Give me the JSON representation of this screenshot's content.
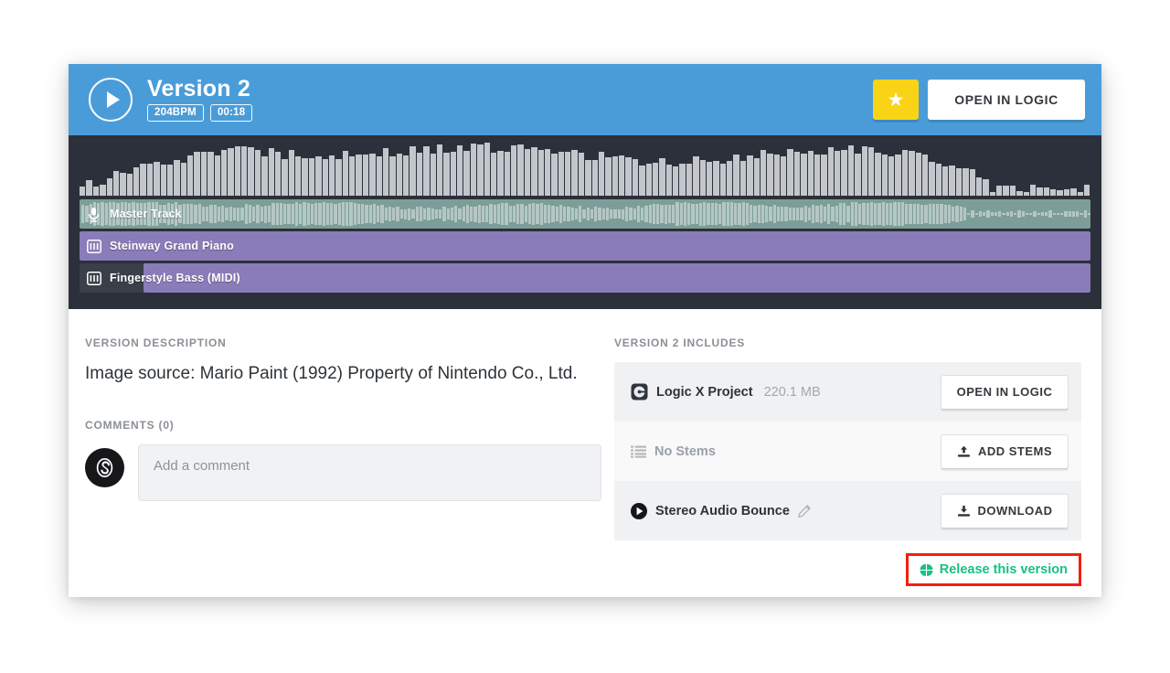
{
  "header": {
    "play_icon": "play-icon",
    "title": "Version 2",
    "bpm_badge": "204BPM",
    "duration_badge": "00:18",
    "star_icon": "star-icon",
    "star_label": "★",
    "open_in_logic_label": "OPEN IN LOGIC",
    "bg_color": "#4a9cd9",
    "star_color": "#f9d416"
  },
  "waveform": {
    "bg_color": "#2b303a",
    "bar_color": "#c3c7cc",
    "tracks": [
      {
        "name": "Master Track",
        "icon": "microphone-icon",
        "color": "#7d9e98",
        "kind": "audio"
      },
      {
        "name": "Steinway Grand Piano",
        "icon": "midi-keyboard-icon",
        "color": "#8a7cb8",
        "kind": "midi"
      },
      {
        "name": "Fingerstyle Bass (MIDI)",
        "icon": "midi-keyboard-icon",
        "color": "#8a7cb8",
        "kind": "midi"
      }
    ]
  },
  "description": {
    "section_label": "VERSION DESCRIPTION",
    "text": "Image source: Mario Paint (1992) Property of Nintendo Co., Ltd."
  },
  "comments": {
    "section_label": "COMMENTS (0)",
    "count": 0,
    "avatar_icon": "user-avatar-icon",
    "input_placeholder": "Add a comment",
    "input_value": ""
  },
  "includes": {
    "section_label": "VERSION 2 INCLUDES",
    "rows": [
      {
        "icon": "logic-project-icon",
        "title": "Logic X Project",
        "size": "220.1 MB",
        "button_label": "OPEN IN LOGIC",
        "button_icon": "",
        "muted": false
      },
      {
        "icon": "stems-list-icon",
        "title": "No Stems",
        "size": "",
        "button_label": "ADD STEMS",
        "button_icon": "upload-icon",
        "muted": true
      },
      {
        "icon": "play-circle-icon",
        "title": "Stereo Audio Bounce",
        "size": "",
        "edit_icon": "pencil-icon",
        "button_label": "DOWNLOAD",
        "button_icon": "download-icon",
        "muted": false
      }
    ]
  },
  "release": {
    "icon": "globe-icon",
    "label": "Release this version",
    "color": "#17c181",
    "highlight_color": "#f41e0e"
  }
}
